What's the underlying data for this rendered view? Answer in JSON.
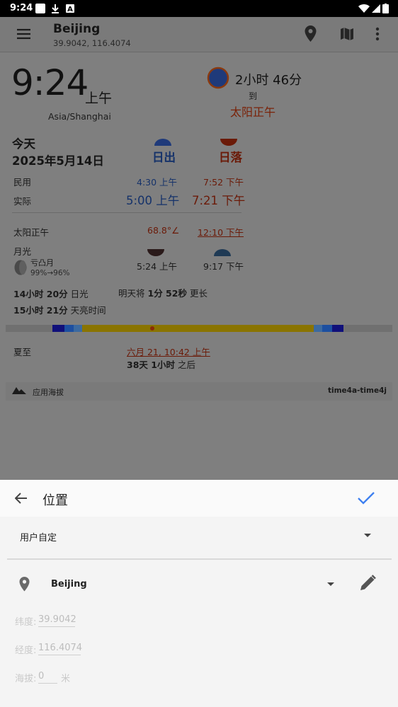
{
  "status_bar": {
    "time": "9:24"
  },
  "toolbar": {
    "title": "Beijing",
    "subtitle": "39.9042, 116.4074"
  },
  "clock": {
    "time": "9:24",
    "ampm": "上午",
    "timezone": "Asia/Shanghai",
    "countdown": "2小时 46分",
    "to": "到",
    "target": "太阳正午"
  },
  "sun": {
    "day_label": "今天",
    "date": "2025年5月14日",
    "sunrise_header": "日出",
    "sunset_header": "日落",
    "rows": [
      {
        "label": "民用",
        "rise": "4:30 上午",
        "set": "7:52 下午"
      },
      {
        "label": "实际",
        "rise": "5:00 上午",
        "set": "7:21 下午"
      }
    ],
    "noon_label": "太阳正午",
    "noon_angle": "68.8°∠",
    "noon_time": "12:10 下午",
    "moon_label": "月光",
    "moon_phase": "亏凸月",
    "moon_illum": "99%→96%",
    "moonrise": "5:24 上午",
    "moonset": "9:17 下午",
    "daylight_value": "14小时 20分",
    "daylight_suffix": "日光",
    "twilight_value": "15小时 21分",
    "twilight_suffix": "天亮时间",
    "tomorrow_prefix": "明天将",
    "tomorrow_value": "1分 52秒",
    "tomorrow_suffix": "更长"
  },
  "solstice": {
    "label": "夏至",
    "date": "六月 21, 10:42 上午",
    "remaining_value": "38天 1小时",
    "remaining_suffix": "之后"
  },
  "footer": {
    "altitude_label": "应用海拔",
    "version": "time4a-time4j"
  },
  "sheet": {
    "title": "位置",
    "mode": "用户自定",
    "location": "Beijing",
    "lat_label": "纬度:",
    "lat_value": "39.9042",
    "lon_label": "经度:",
    "lon_value": "116.4074",
    "alt_label": "海拔:",
    "alt_value": "0",
    "alt_unit": "米"
  },
  "colors": {
    "accent": "#3d7ff0",
    "sheet_bg": "#f4f4f4",
    "scrim": "#7f7f7f"
  }
}
